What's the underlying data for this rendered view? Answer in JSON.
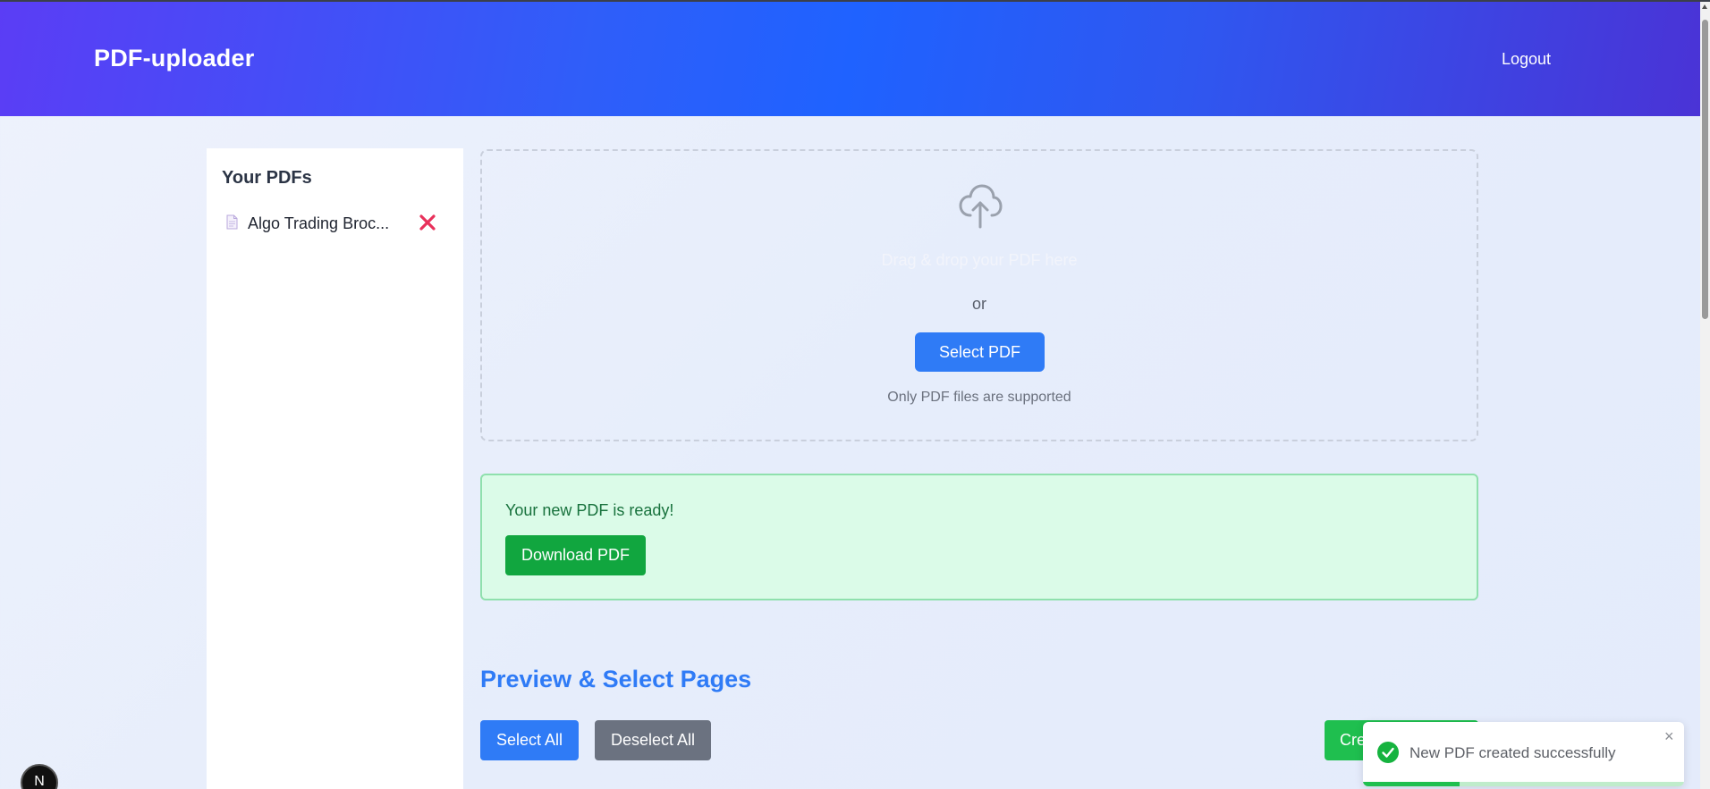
{
  "header": {
    "brand": "PDF-uploader",
    "logout_label": "Logout"
  },
  "sidebar": {
    "title": "Your PDFs",
    "items": [
      {
        "name": "Algo Trading Broc...",
        "icon": "file-icon",
        "delete_icon": "close-x-icon"
      }
    ]
  },
  "dropzone": {
    "icon": "cloud-upload-icon",
    "drop_text": "Drag & drop your PDF here",
    "or_text": "or",
    "select_button_label": "Select PDF",
    "hint_text": "Only PDF files are supported"
  },
  "ready": {
    "message": "Your new PDF is ready!",
    "download_label": "Download PDF"
  },
  "preview": {
    "title": "Preview & Select Pages",
    "select_all_label": "Select All",
    "deselect_all_label": "Deselect All",
    "create_label": "Create New PDF"
  },
  "toast": {
    "message": "New PDF created successfully",
    "close_symbol": "×",
    "icon": "check-circle-icon",
    "progress": 0.3
  },
  "dev_badge": {
    "letter": "N"
  },
  "colors": {
    "primary": "#2f7bf6",
    "success": "#11a63f",
    "danger": "#e8315b",
    "gray_button": "#6b7280"
  }
}
